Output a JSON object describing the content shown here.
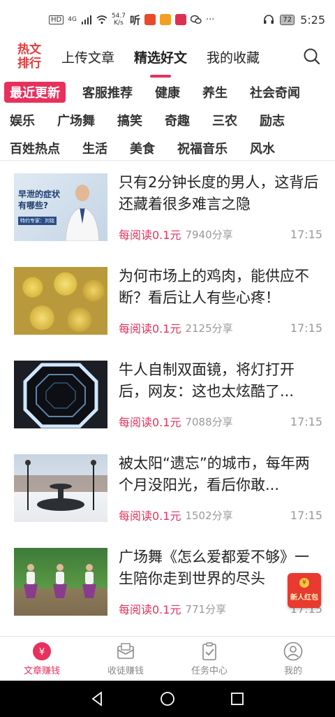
{
  "status_bar": {
    "net_label": "HD",
    "net_type": "4G",
    "speed_value": "54.7",
    "speed_unit": "K/s",
    "app_icon_1": "听",
    "more": "···",
    "battery": "72",
    "time": "5:25"
  },
  "header": {
    "logo_line1": "热文",
    "logo_line2": "排行",
    "tabs": [
      {
        "label": "上传文章"
      },
      {
        "label": "精选好文"
      },
      {
        "label": "我的收藏"
      }
    ],
    "active_tab": "精选好文"
  },
  "categories": {
    "row1": [
      "最近更新",
      "客服推荐",
      "健康",
      "养生",
      "社会奇闻"
    ],
    "row2": [
      "娱乐",
      "广场舞",
      "搞笑",
      "奇趣",
      "三农",
      "励志"
    ],
    "row3": [
      "百姓热点",
      "生活",
      "美食",
      "祝福音乐",
      "风水"
    ],
    "active": "最近更新"
  },
  "articles": [
    {
      "title": "只有2分钟长度的男人，这背后还藏着很多难言之隐",
      "reward": "每阅读0.1元",
      "shares": "7940分享",
      "time": "17:15",
      "thumb_text": "早泄的症状有哪些?",
      "thumb_caption": "特约专家：",
      "thumb_name": "刘铭"
    },
    {
      "title": "为何市场上的鸡肉，能供应不断？看后让人有些心疼！",
      "reward": "每阅读0.1元",
      "shares": "2125分享",
      "time": "17:15"
    },
    {
      "title": "牛人自制双面镜，将灯打开后，网友：这也太炫酷了...",
      "reward": "每阅读0.1元",
      "shares": "7088分享",
      "time": "17:15"
    },
    {
      "title": "被太阳“遗忘”的城市，每年两个月没阳光，看后你敢...",
      "reward": "每阅读0.1元",
      "shares": "1502分享",
      "time": "17:15"
    },
    {
      "title": "广场舞《怎么爱都爱不够》一生陪你走到世界的尽头",
      "reward": "每阅读0.1元",
      "shares": "771分享",
      "time": "17:15"
    }
  ],
  "red_packet": {
    "label": "新人红包",
    "coin": "¥"
  },
  "bottom_nav": [
    {
      "label": "文章赚钱",
      "icon": "yuan-coin-icon"
    },
    {
      "label": "收徒赚钱",
      "icon": "envelope-icon"
    },
    {
      "label": "任务中心",
      "icon": "clipboard-check-icon"
    },
    {
      "label": "我的",
      "icon": "user-icon"
    }
  ],
  "colors": {
    "accent": "#e8305c",
    "logo": "#e03c3c",
    "red_packet": "#e83a2f"
  }
}
